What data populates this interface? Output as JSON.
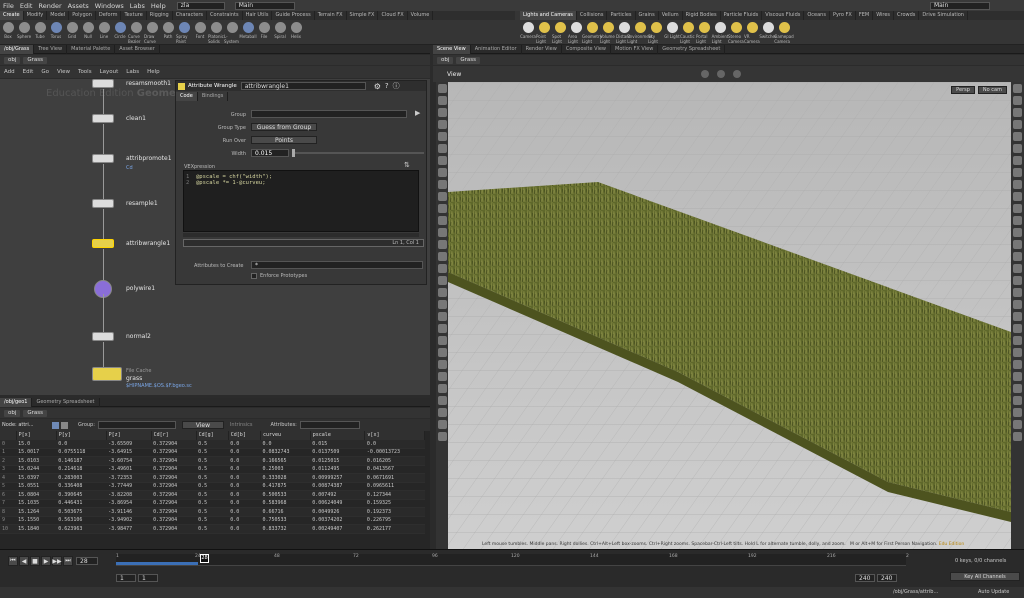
{
  "menu": [
    "File",
    "Edit",
    "Render",
    "Assets",
    "Windows",
    "Labs",
    "Help"
  ],
  "scene_file": "zla",
  "desktop": "Main",
  "desktop_right": "Main",
  "shelf_left": {
    "tabs": [
      "Create",
      "Modify",
      "Model",
      "Polygon",
      "Deform",
      "Texture",
      "Rigging",
      "Characters",
      "Constraints",
      "Hair Utils",
      "Guide Process",
      "Terrain FX",
      "Simple FX",
      "Cloud FX",
      "Volume"
    ],
    "tools": [
      "Box",
      "Sphere",
      "Tube",
      "Torus",
      "Grid",
      "Null",
      "Line",
      "Circle",
      "Curve Bezier",
      "Draw Curve",
      "Path",
      "Spray Paint",
      "Font",
      "Platonic Solids",
      "L-System",
      "Metaball",
      "File",
      "Spiral",
      "Helix"
    ]
  },
  "shelf_right": {
    "tabs": [
      "Lights and Cameras",
      "Collisions",
      "Particles",
      "Grains",
      "Vellum",
      "Rigid Bodies",
      "Particle Fluids",
      "Viscous Fluids",
      "Oceans",
      "Pyro FX",
      "FEM",
      "Wires",
      "Crowds",
      "Drive Simulation"
    ],
    "tools": [
      "Camera",
      "Point Light",
      "Spot Light",
      "Area Light",
      "Geometry Light",
      "Volume Light",
      "Distant Light",
      "Environment Light",
      "Sky Light",
      "GI Light",
      "Caustic Light",
      "Portal Light",
      "Ambient Light",
      "Stereo Camera",
      "VR Camera",
      "Switcher",
      "Gamepad Camera"
    ]
  },
  "left_tabs": [
    "/obj/Grass",
    "Tree View",
    "Material Palette",
    "Asset Browser"
  ],
  "path": {
    "obj": "obj",
    "node": "Grass"
  },
  "net_menu": [
    "Add",
    "Edit",
    "Go",
    "View",
    "Tools",
    "Layout",
    "Labs",
    "Help"
  ],
  "watermark": "Education Edition",
  "watermark_ctx": "Geometry",
  "nodes": [
    {
      "label": "resamsmooth1",
      "selected": false
    },
    {
      "label": "clean1",
      "selected": false
    },
    {
      "label": "attribpromote1",
      "selected": false,
      "sub": "Cd"
    },
    {
      "label": "resample1",
      "selected": false
    },
    {
      "label": "attribwrangle1",
      "selected": true
    },
    {
      "label": "polywire1",
      "selected": false
    },
    {
      "label": "normal2",
      "selected": false
    },
    {
      "label": "grass",
      "selected": false,
      "sub": "$HIPNAME.$OS.$F.bgeo.sc",
      "title": "File Cache"
    }
  ],
  "parm": {
    "type": "Attribute Wrangle",
    "name": "attribwrangle1",
    "tabs": [
      "Code",
      "Bindings"
    ],
    "group_label": "Group",
    "group_value": "",
    "group_type_label": "Group Type",
    "group_type_value": "Guess from Group",
    "run_over_label": "Run Over",
    "run_over_value": "Points",
    "width_label": "Width",
    "width_value": "0.015",
    "vex_label": "VEXpression",
    "code_lines": [
      "@pscale = chf(\"width\");",
      "@pscale *= 1-@curveu;"
    ],
    "cursor_pos": "Ln 1, Col 1",
    "attr_create_label": "Attributes to Create",
    "attr_create_value": "*",
    "enforce_label": "Enforce Prototypes"
  },
  "sheet_tabs": [
    "/obj/geo1",
    "Geometry Spreadsheet"
  ],
  "sheet": {
    "node_label": "Node: attri...",
    "group_label": "Group:",
    "view_label": "View",
    "intrinsics": "Intrinsics",
    "attributes": "Attributes:",
    "headers": [
      "",
      "P[x]",
      "P[y]",
      "P[z]",
      "Cd[r]",
      "Cd[g]",
      "Cd[b]",
      "curveu",
      "pscale",
      "v[x]"
    ],
    "rows": [
      [
        "0",
        "15.0",
        "0.0",
        "-3.65509",
        "0.372904",
        "0.5",
        "0.0",
        "0.0",
        "0.015",
        "0.0"
      ],
      [
        "1",
        "15.0017",
        "0.0755118",
        "-3.64915",
        "0.372904",
        "0.5",
        "0.0",
        "0.0832743",
        "0.0137509",
        "-0.00013723"
      ],
      [
        "2",
        "15.0103",
        "0.146187",
        "-3.60754",
        "0.372904",
        "0.5",
        "0.0",
        "0.166565",
        "0.0125015",
        "0.016205"
      ],
      [
        "3",
        "15.0244",
        "0.214618",
        "-3.49601",
        "0.372904",
        "0.5",
        "0.0",
        "0.25003",
        "0.0112495",
        "0.0413567"
      ],
      [
        "4",
        "15.0397",
        "0.283003",
        "-3.72353",
        "0.372904",
        "0.5",
        "0.0",
        "0.333028",
        "0.00999257",
        "0.0671691"
      ],
      [
        "5",
        "15.0551",
        "0.336408",
        "-3.77449",
        "0.372904",
        "0.5",
        "0.0",
        "0.417875",
        "0.00874387",
        "0.0965611"
      ],
      [
        "6",
        "15.0804",
        "0.390645",
        "-3.82208",
        "0.372904",
        "0.5",
        "0.0",
        "0.500533",
        "0.007492",
        "0.127344"
      ],
      [
        "7",
        "15.1035",
        "0.446431",
        "-3.86954",
        "0.372904",
        "0.5",
        "0.0",
        "0.583968",
        "0.00624049",
        "0.159325"
      ],
      [
        "8",
        "15.1264",
        "0.503675",
        "-3.91146",
        "0.372904",
        "0.5",
        "0.0",
        "0.66716",
        "0.0049926",
        "0.192373"
      ],
      [
        "9",
        "15.1550",
        "0.563106",
        "-3.94902",
        "0.372904",
        "0.5",
        "0.0",
        "0.750533",
        "0.00374202",
        "0.226795"
      ],
      [
        "10",
        "15.1840",
        "0.623963",
        "-3.98477",
        "0.372904",
        "0.5",
        "0.0",
        "0.833732",
        "0.00249407",
        "0.262177"
      ]
    ]
  },
  "right_tabs": [
    "Scene View",
    "Animation Editor",
    "Render View",
    "Composite View",
    "Motion FX View",
    "Geometry Spreadsheet"
  ],
  "view": {
    "title": "View",
    "persp": "Persp",
    "cam": "No cam",
    "help": "Left mouse tumbles. Middle pans. Right dollies. Ctrl+Alt+Left box-zooms. Ctrl+Right zooms. Spacebar-Ctrl-Left tilts. Hold L for alternate tumble, dolly, and zoom.",
    "help2": "M or Alt+M for First Person Navigation.",
    "edu": "Edu Edition"
  },
  "timeline": {
    "frame": "28",
    "marks": [
      "1",
      "24",
      "48",
      "72",
      "96",
      "120",
      "144",
      "168",
      "192",
      "216",
      "2"
    ],
    "start": "1",
    "start2": "1",
    "end": "240",
    "end2": "240",
    "keys": "0 keys, 0/0 channels",
    "channels": "Key All Channels"
  },
  "status": {
    "path": "/obj/Grass/attrib...",
    "update": "Auto Update"
  },
  "colors": {
    "accent": "#e6d04a",
    "grass": "#5c6526",
    "viewport_bg": "#c2c2c2"
  }
}
